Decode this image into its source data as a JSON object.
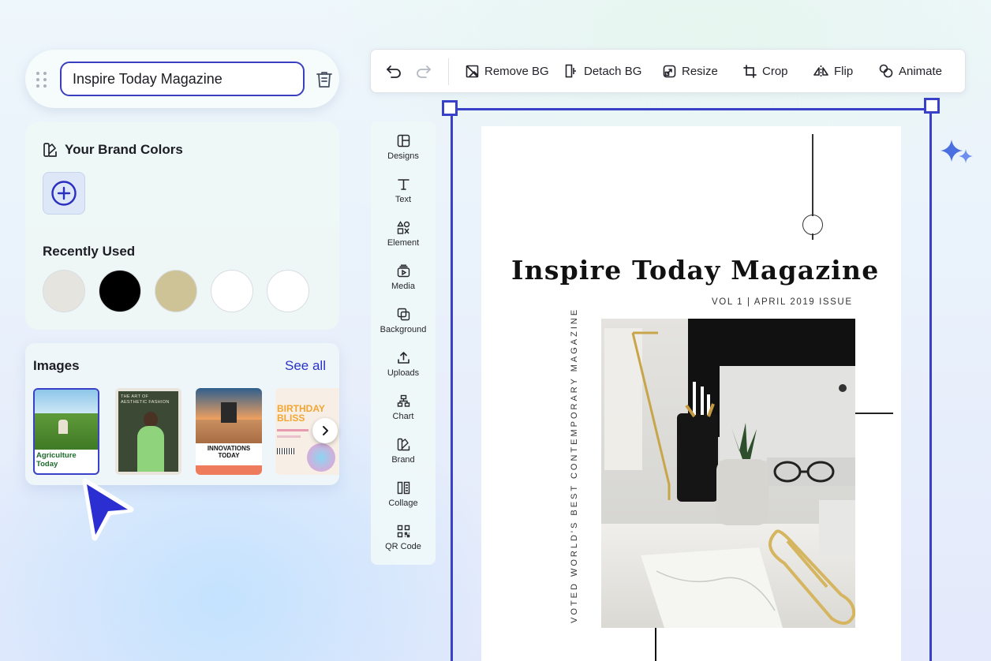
{
  "project": {
    "title_value": "Inspire Today Magazine"
  },
  "brand_colors": {
    "title": "Your Brand Colors",
    "recently_used_title": "Recently Used",
    "recent_colors": [
      "#e6e4df",
      "#000000",
      "#cdc397",
      "#ffffff",
      "#ffffff"
    ]
  },
  "images": {
    "title": "Images",
    "see_all": "See all",
    "thumbnails": [
      {
        "title_line1": "Agriculture",
        "title_line2": "Today",
        "selected": true
      },
      {
        "title_line1": "THE ART OF",
        "title_line2": "AESTHETIC FASHION"
      },
      {
        "title_line1": "INNOVATIONS",
        "title_line2": "TODAY"
      },
      {
        "title_line1": "BIRTHDAY",
        "title_line2": "BLISS"
      }
    ]
  },
  "toolbar": {
    "remove_bg": "Remove BG",
    "detach_bg": "Detach BG",
    "resize": "Resize",
    "crop": "Crop",
    "flip": "Flip",
    "animate": "Animate"
  },
  "sidenav": {
    "items": [
      "Designs",
      "Text",
      "Element",
      "Media",
      "Background",
      "Uploads",
      "Chart",
      "Brand",
      "Collage",
      "QR Code"
    ]
  },
  "canvas": {
    "title": "Inspire Today Magazine",
    "volume_line": "VOL 1 | APRIL 2019 ISSUE",
    "vertical_tagline": "VOTED WORLD'S BEST CONTEMPORARY MAGAZINE"
  },
  "colors": {
    "accent": "#3a41c9",
    "link": "#2a33c9"
  }
}
